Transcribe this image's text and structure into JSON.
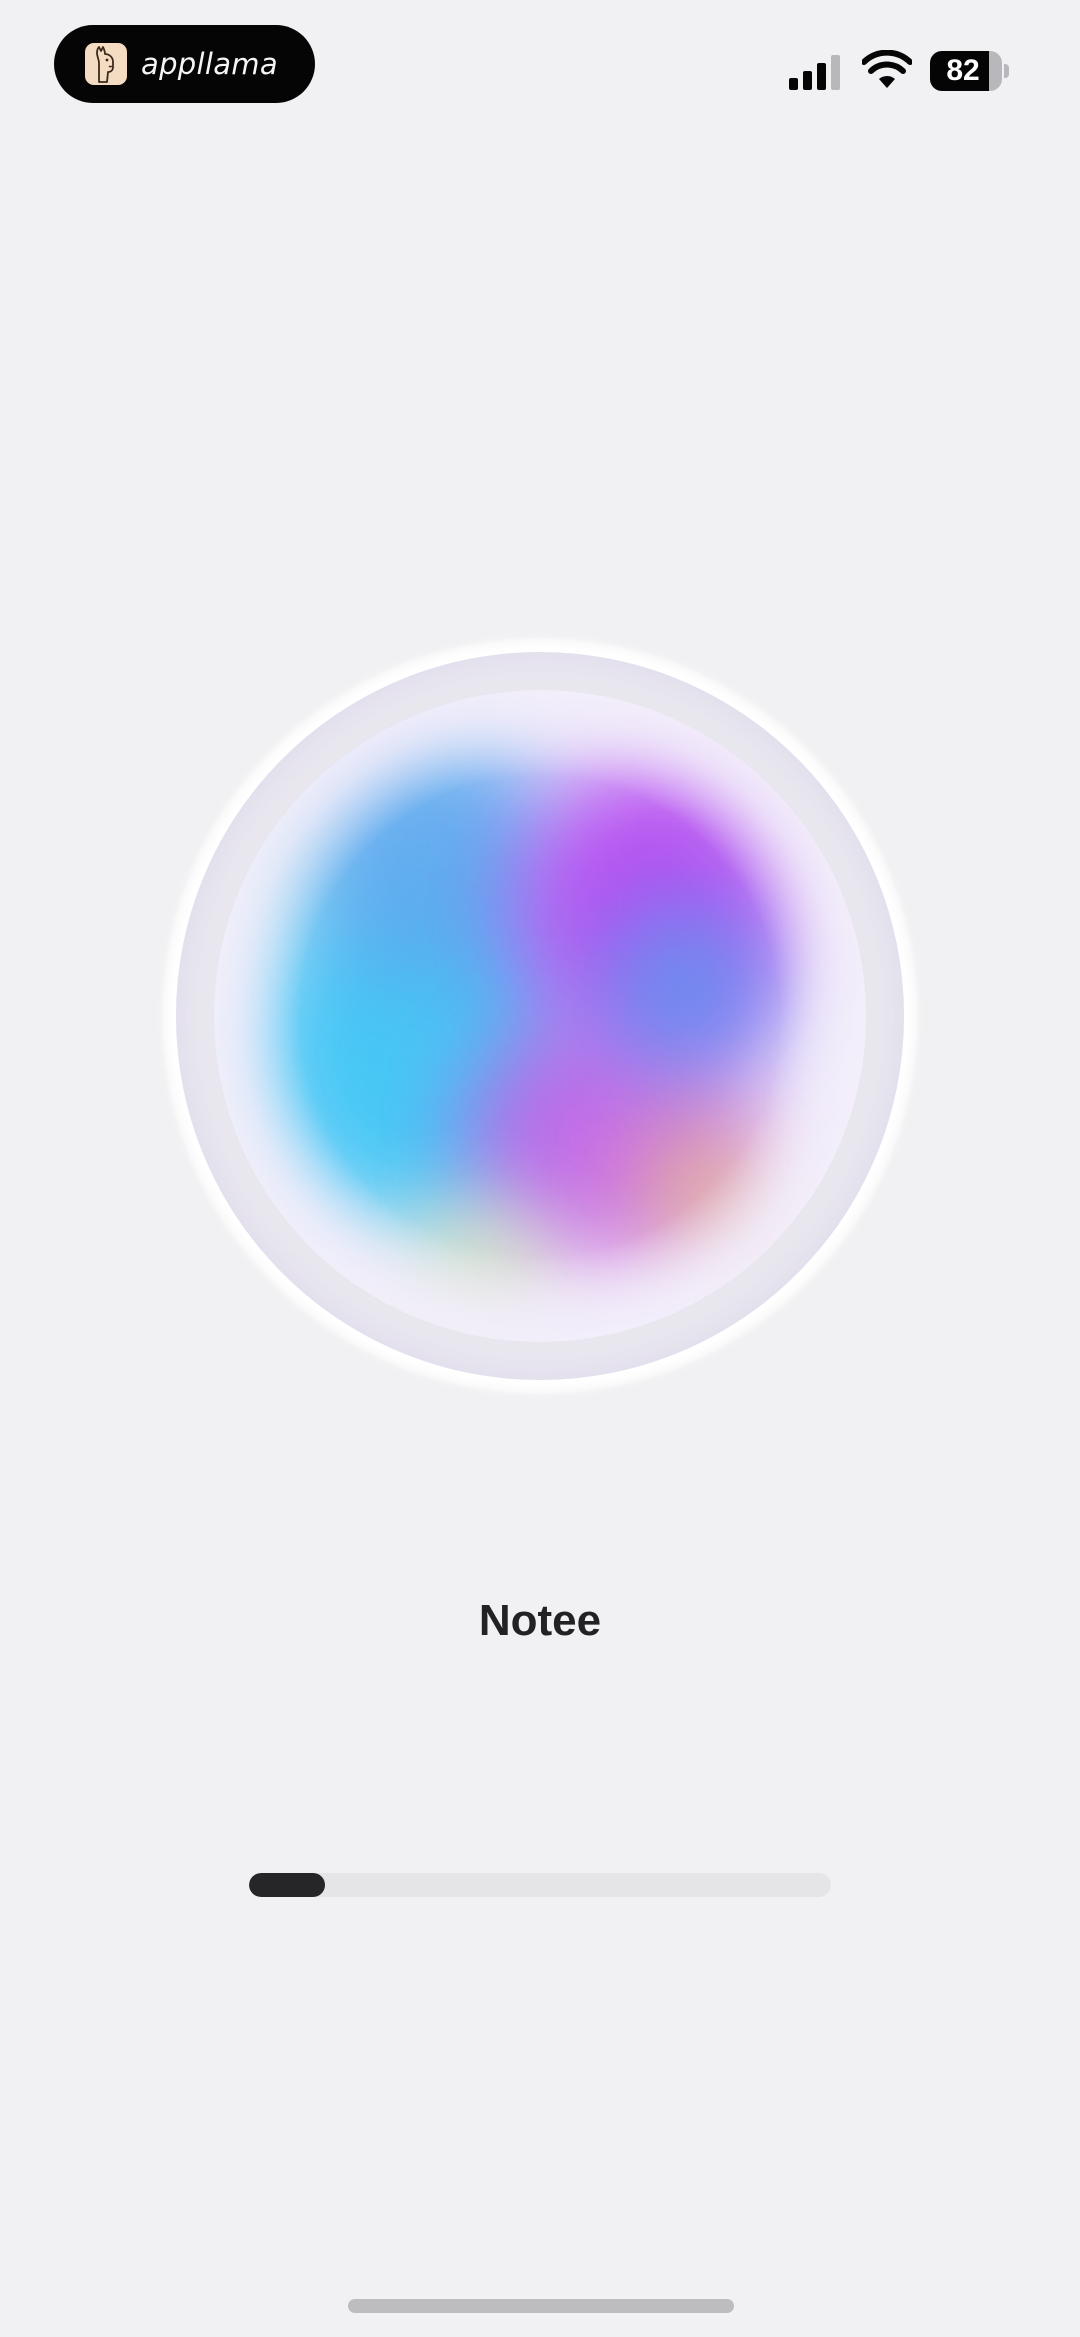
{
  "status_bar": {
    "brand_name": "appllama",
    "brand_logo_icon": "llama-logo-icon",
    "signal_icon": "cellular-signal-icon",
    "wifi_icon": "wifi-icon",
    "battery_level": "82",
    "battery_fraction": 0.82
  },
  "orb": {
    "icon": "gradient-orb-icon",
    "colors": [
      "#3fc6f5",
      "#5aa8ee",
      "#b44af0",
      "#c55ae6",
      "#6a8ef0",
      "#cfe6a8",
      "#e8c07c"
    ]
  },
  "main": {
    "title": "Notee"
  },
  "progress": {
    "fraction": 0.13,
    "fill_color": "#262628",
    "track_color": "#e5e5e8"
  },
  "home_indicator": {
    "color": "#bdbdc0"
  }
}
